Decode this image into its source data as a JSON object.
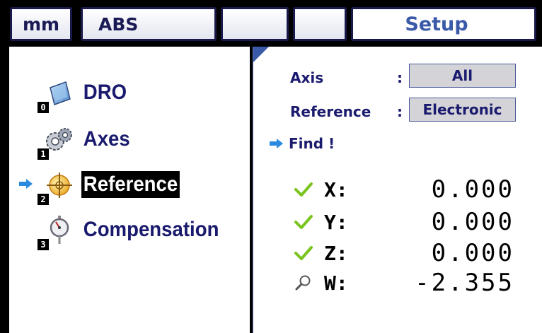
{
  "header": {
    "units": "mm",
    "mode": "ABS",
    "empty_tab_1": "",
    "empty_tab_2": "",
    "screen_title": "Setup"
  },
  "menu": {
    "items": [
      {
        "label": "DRO",
        "number": "0",
        "icon": "monitor-icon",
        "selected": false
      },
      {
        "label": "Axes",
        "number": "1",
        "icon": "gears-icon",
        "selected": false
      },
      {
        "label": "Reference",
        "number": "2",
        "icon": "crosshair-target-icon",
        "selected": true
      },
      {
        "label": "Compensation",
        "number": "3",
        "icon": "dial-indicator-icon",
        "selected": false
      }
    ]
  },
  "reference_panel": {
    "axis_label": "Axis",
    "axis_colon": ":",
    "axis_value": "All",
    "reference_label": "Reference",
    "reference_colon": ":",
    "reference_value": "Electronic",
    "find_label": "Find !",
    "axes": [
      {
        "name": "X:",
        "value": "0.000",
        "status": "checkmark-icon"
      },
      {
        "name": "Y:",
        "value": "0.000",
        "status": "checkmark-icon"
      },
      {
        "name": "Z:",
        "value": "0.000",
        "status": "checkmark-icon"
      },
      {
        "name": "W:",
        "value": "-2.355",
        "status": "magnifier-icon"
      }
    ]
  },
  "colors": {
    "text_navy": "#1a1a6e",
    "title_blue": "#3a5aa8",
    "arrow_blue": "#2a8ae0",
    "check_green": "#7ac41e",
    "field_gray": "#d4d4d8"
  }
}
